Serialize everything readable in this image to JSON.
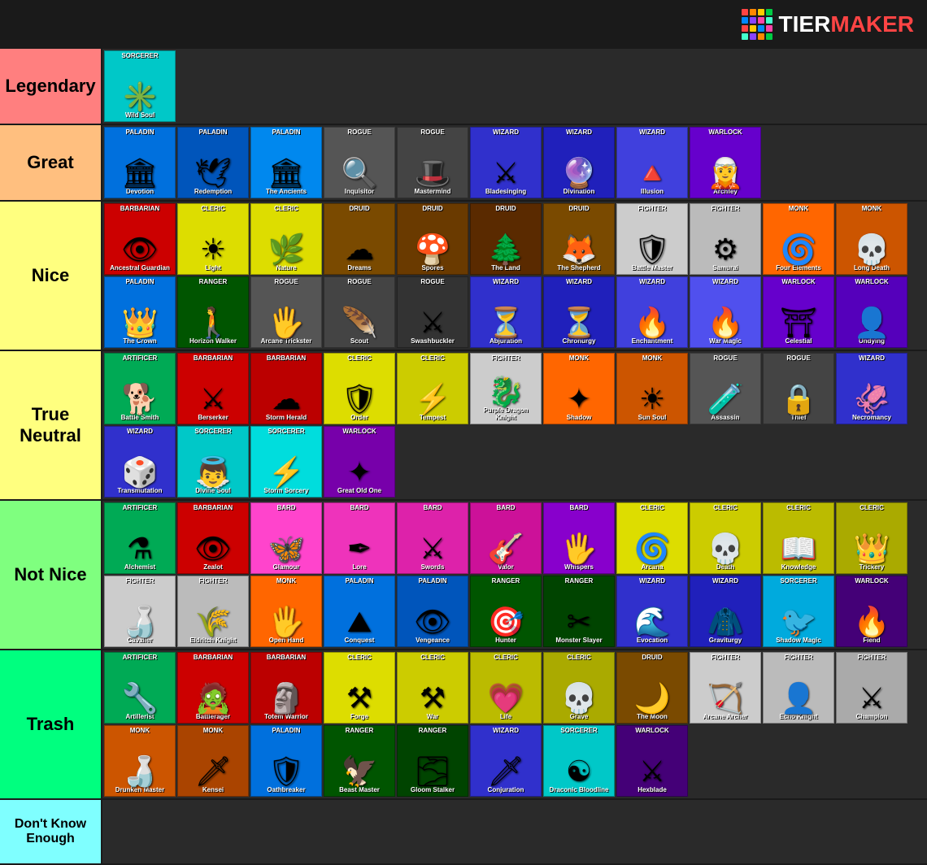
{
  "header": {
    "logo_text": "TIERMAKER"
  },
  "logo_colors": [
    "#ff4444",
    "#ff8800",
    "#ffcc00",
    "#00cc44",
    "#0088ff",
    "#8844ff",
    "#ff44aa",
    "#44ffcc",
    "#ff4444",
    "#ffcc00",
    "#0088ff",
    "#ff44aa",
    "#44ffcc",
    "#8844ff",
    "#ff8800",
    "#00cc44"
  ],
  "tiers": [
    {
      "id": "legendary",
      "label": "Legendary",
      "label_color": "#ffaaaa",
      "items": [
        {
          "class": "SORCERER",
          "name": "Wild Soul",
          "icon": "✳",
          "bg": "#00c8c8"
        }
      ]
    },
    {
      "id": "great",
      "label": "Great",
      "label_color": "#ffddaa",
      "items": [
        {
          "class": "PALADIN",
          "name": "Devotion",
          "icon": "🏛",
          "bg": "#0070dd"
        },
        {
          "class": "PALADIN",
          "name": "Redemption",
          "icon": "🕊",
          "bg": "#0055bb"
        },
        {
          "class": "PALADIN",
          "name": "The Ancients",
          "icon": "🏛",
          "bg": "#0088ee"
        },
        {
          "class": "ROGUE",
          "name": "Inquisitor",
          "icon": "🔍",
          "bg": "#555555"
        },
        {
          "class": "ROGUE",
          "name": "Mastermind",
          "icon": "🎩",
          "bg": "#444444"
        },
        {
          "class": "WIZARD",
          "name": "Bladesinging",
          "icon": "⚔",
          "bg": "#3030cc"
        },
        {
          "class": "WIZARD",
          "name": "Divination",
          "icon": "🔮",
          "bg": "#2020bb"
        },
        {
          "class": "WIZARD",
          "name": "Illusion",
          "icon": "🔺",
          "bg": "#4040dd"
        },
        {
          "class": "WARLOCK",
          "name": "Archfey",
          "icon": "🧝",
          "bg": "#6600cc"
        }
      ]
    },
    {
      "id": "nice",
      "label": "Nice",
      "label_color": "#ffffaa",
      "items_row1": [
        {
          "class": "BARBARIAN",
          "name": "Ancestral Guardian",
          "icon": "👁",
          "bg": "#cc0000"
        },
        {
          "class": "CLERIC",
          "name": "Light",
          "icon": "☀",
          "bg": "#dddd00"
        },
        {
          "class": "CLERIC",
          "name": "Nature",
          "icon": "🌿",
          "bg": "#dddd00"
        },
        {
          "class": "DRUID",
          "name": "Dreams",
          "icon": "☁",
          "bg": "#7a4a00"
        },
        {
          "class": "DRUID",
          "name": "Spores",
          "icon": "🍄",
          "bg": "#6a3a00"
        },
        {
          "class": "DRUID",
          "name": "The Land",
          "icon": "🌲",
          "bg": "#5a2a00"
        },
        {
          "class": "DRUID",
          "name": "The Shepherd",
          "icon": "🦊",
          "bg": "#7a4a00"
        },
        {
          "class": "FIGHTER",
          "name": "Battle Master",
          "icon": "🛡",
          "bg": "#cccccc"
        },
        {
          "class": "FIGHTER",
          "name": "Samurai",
          "icon": "⚙",
          "bg": "#bbbbbb"
        },
        {
          "class": "MONK",
          "name": "Four Elements",
          "icon": "🌀",
          "bg": "#ff6600"
        },
        {
          "class": "MONK",
          "name": "Long Death",
          "icon": "💀",
          "bg": "#cc5500"
        }
      ],
      "items_row2": [
        {
          "class": "PALADIN",
          "name": "The Crown",
          "icon": "👑",
          "bg": "#0070dd"
        },
        {
          "class": "RANGER",
          "name": "Horizon Walker",
          "icon": "🚶",
          "bg": "#005500"
        },
        {
          "class": "ROGUE",
          "name": "Arcane Trickster",
          "icon": "🖐",
          "bg": "#555555"
        },
        {
          "class": "ROGUE",
          "name": "Scout",
          "icon": "🪶",
          "bg": "#444444"
        },
        {
          "class": "ROGUE",
          "name": "Swashbuckler",
          "icon": "⚔",
          "bg": "#333333"
        },
        {
          "class": "WIZARD",
          "name": "Abjuration",
          "icon": "⏳",
          "bg": "#3030cc"
        },
        {
          "class": "WIZARD",
          "name": "Chronurgy",
          "icon": "⏳",
          "bg": "#2020bb"
        },
        {
          "class": "WIZARD",
          "name": "Enchantment",
          "icon": "🔥",
          "bg": "#4040dd"
        },
        {
          "class": "WIZARD",
          "name": "War Magic",
          "icon": "🔥",
          "bg": "#5050ee"
        },
        {
          "class": "WARLOCK",
          "name": "Celestial",
          "icon": "⛩",
          "bg": "#6600cc"
        },
        {
          "class": "WARLOCK",
          "name": "Undying",
          "icon": "👤",
          "bg": "#5500bb"
        }
      ]
    },
    {
      "id": "trueneutral",
      "label": "True Neutral",
      "label_color": "#ffffaa",
      "items_row1": [
        {
          "class": "ARTIFICER",
          "name": "Battle Smith",
          "icon": "🐕",
          "bg": "#00aa55"
        },
        {
          "class": "BARBARIAN",
          "name": "Berserker",
          "icon": "⚔",
          "bg": "#cc0000"
        },
        {
          "class": "BARBARIAN",
          "name": "Storm Herald",
          "icon": "☁",
          "bg": "#bb0000"
        },
        {
          "class": "CLERIC",
          "name": "Order",
          "icon": "🛡",
          "bg": "#dddd00"
        },
        {
          "class": "CLERIC",
          "name": "Tempest",
          "icon": "⚡",
          "bg": "#cccc00"
        },
        {
          "class": "FIGHTER",
          "name": "Purple Dragon Knight",
          "icon": "🐉",
          "bg": "#cccccc"
        },
        {
          "class": "MONK",
          "name": "Shadow",
          "icon": "✦",
          "bg": "#ff6600"
        },
        {
          "class": "MONK",
          "name": "Sun Soul",
          "icon": "☀",
          "bg": "#cc5500"
        },
        {
          "class": "ROGUE",
          "name": "Assassin",
          "icon": "🧪",
          "bg": "#555555"
        },
        {
          "class": "ROGUE",
          "name": "Thief",
          "icon": "🔒",
          "bg": "#444444"
        },
        {
          "class": "WIZARD",
          "name": "Necromancy",
          "icon": "🦑",
          "bg": "#3030cc"
        }
      ],
      "items_row2": [
        {
          "class": "WIZARD",
          "name": "Transmutation",
          "icon": "🎲",
          "bg": "#3030cc"
        },
        {
          "class": "SORCERER",
          "name": "Divine Soul",
          "icon": "👼",
          "bg": "#00c8c8"
        },
        {
          "class": "SORCERER",
          "name": "Storm Sorcery",
          "icon": "⚡",
          "bg": "#00dddd"
        },
        {
          "class": "WARLOCK",
          "name": "Great Old One",
          "icon": "✦",
          "bg": "#7700aa"
        }
      ]
    },
    {
      "id": "notnice",
      "label": "Not Nice",
      "label_color": "#aaffaa",
      "items_row1": [
        {
          "class": "ARTIFICER",
          "name": "Alchemist",
          "icon": "⚗",
          "bg": "#00aa55"
        },
        {
          "class": "BARBARIAN",
          "name": "Zealot",
          "icon": "👁",
          "bg": "#cc0000"
        },
        {
          "class": "BARD",
          "name": "Glamour",
          "icon": "🦋",
          "bg": "#ff44cc"
        },
        {
          "class": "BARD",
          "name": "Lore",
          "icon": "✒",
          "bg": "#ee33bb"
        },
        {
          "class": "BARD",
          "name": "Swords",
          "icon": "⚔",
          "bg": "#dd22aa"
        },
        {
          "class": "BARD",
          "name": "Valor",
          "icon": "🎸",
          "bg": "#cc1199"
        },
        {
          "class": "BARD",
          "name": "Whispers",
          "icon": "🖐",
          "bg": "#8800cc"
        },
        {
          "class": "CLERIC",
          "name": "Arcana",
          "icon": "🌀",
          "bg": "#dddd00"
        },
        {
          "class": "CLERIC",
          "name": "Death",
          "icon": "💀",
          "bg": "#cccc00"
        },
        {
          "class": "CLERIC",
          "name": "Knowledge",
          "icon": "📖",
          "bg": "#bbbb00"
        },
        {
          "class": "CLERIC",
          "name": "Trickery",
          "icon": "👑",
          "bg": "#aaaa00"
        }
      ],
      "items_row2": [
        {
          "class": "FIGHTER",
          "name": "Cavalier",
          "icon": "🍶",
          "bg": "#cccccc"
        },
        {
          "class": "FIGHTER",
          "name": "Eldritch Knight",
          "icon": "🌾",
          "bg": "#bbbbbb"
        },
        {
          "class": "MONK",
          "name": "Open Hand",
          "icon": "🖐",
          "bg": "#ff6600"
        },
        {
          "class": "PALADIN",
          "name": "Conquest",
          "icon": "⛰",
          "bg": "#0070dd"
        },
        {
          "class": "PALADIN",
          "name": "Vengeance",
          "icon": "👁",
          "bg": "#0055bb"
        },
        {
          "class": "RANGER",
          "name": "Hunter",
          "icon": "🎯",
          "bg": "#005500"
        },
        {
          "class": "RANGER",
          "name": "Monster Slayer",
          "icon": "✂",
          "bg": "#004400"
        },
        {
          "class": "WIZARD",
          "name": "Evocation",
          "icon": "🌊",
          "bg": "#3030cc"
        },
        {
          "class": "WIZARD",
          "name": "Graviturgy",
          "icon": "🧥",
          "bg": "#2020bb"
        },
        {
          "class": "SORCERER",
          "name": "Shadow Magic",
          "icon": "🐦",
          "bg": "#00aadd"
        },
        {
          "class": "WARLOCK",
          "name": "Fiend",
          "icon": "🔥",
          "bg": "#440077"
        }
      ]
    },
    {
      "id": "trash",
      "label": "Trash",
      "label_color": "#aaffcc",
      "items_row1": [
        {
          "class": "ARTIFICER",
          "name": "Artillerist",
          "icon": "🔧",
          "bg": "#00aa55"
        },
        {
          "class": "BARBARIAN",
          "name": "Battlerager",
          "icon": "🧟",
          "bg": "#cc0000"
        },
        {
          "class": "BARBARIAN",
          "name": "Totem Warrior",
          "icon": "🗿",
          "bg": "#bb0000"
        },
        {
          "class": "CLERIC",
          "name": "Forge",
          "icon": "⚒",
          "bg": "#dddd00"
        },
        {
          "class": "CLERIC",
          "name": "War",
          "icon": "⚒",
          "bg": "#cccc00"
        },
        {
          "class": "CLERIC",
          "name": "Life",
          "icon": "💗",
          "bg": "#bbbb00"
        },
        {
          "class": "CLERIC",
          "name": "Grave",
          "icon": "💀",
          "bg": "#aaaa00"
        },
        {
          "class": "DRUID",
          "name": "The Moon",
          "icon": "🌙",
          "bg": "#7a4a00"
        },
        {
          "class": "FIGHTER",
          "name": "Arcane Archer",
          "icon": "🏹",
          "bg": "#cccccc"
        },
        {
          "class": "FIGHTER",
          "name": "Echo Knight",
          "icon": "👤",
          "bg": "#bbbbbb"
        },
        {
          "class": "FIGHTER",
          "name": "Champion",
          "icon": "⚔",
          "bg": "#aaaaaa"
        }
      ],
      "items_row2": [
        {
          "class": "MONK",
          "name": "Drunken Master",
          "icon": "🍶",
          "bg": "#cc5500"
        },
        {
          "class": "MONK",
          "name": "Kensei",
          "icon": "🗡",
          "bg": "#aa4400"
        },
        {
          "class": "PALADIN",
          "name": "Oathbreaker",
          "icon": "🛡",
          "bg": "#0070dd"
        },
        {
          "class": "RANGER",
          "name": "Beast Master",
          "icon": "🦅",
          "bg": "#005500"
        },
        {
          "class": "RANGER",
          "name": "Gloom Stalker",
          "icon": "🌫",
          "bg": "#004400"
        },
        {
          "class": "WIZARD",
          "name": "Conjuration",
          "icon": "🗡",
          "bg": "#3030cc"
        },
        {
          "class": "SORCERER",
          "name": "Draconic Bloodline",
          "icon": "☯",
          "bg": "#00c8c8"
        },
        {
          "class": "WARLOCK",
          "name": "Hexblade",
          "icon": "⚔",
          "bg": "#440077"
        }
      ]
    },
    {
      "id": "dontknow",
      "label": "Don't Know Enough",
      "label_color": "#aaffff",
      "items": []
    }
  ]
}
